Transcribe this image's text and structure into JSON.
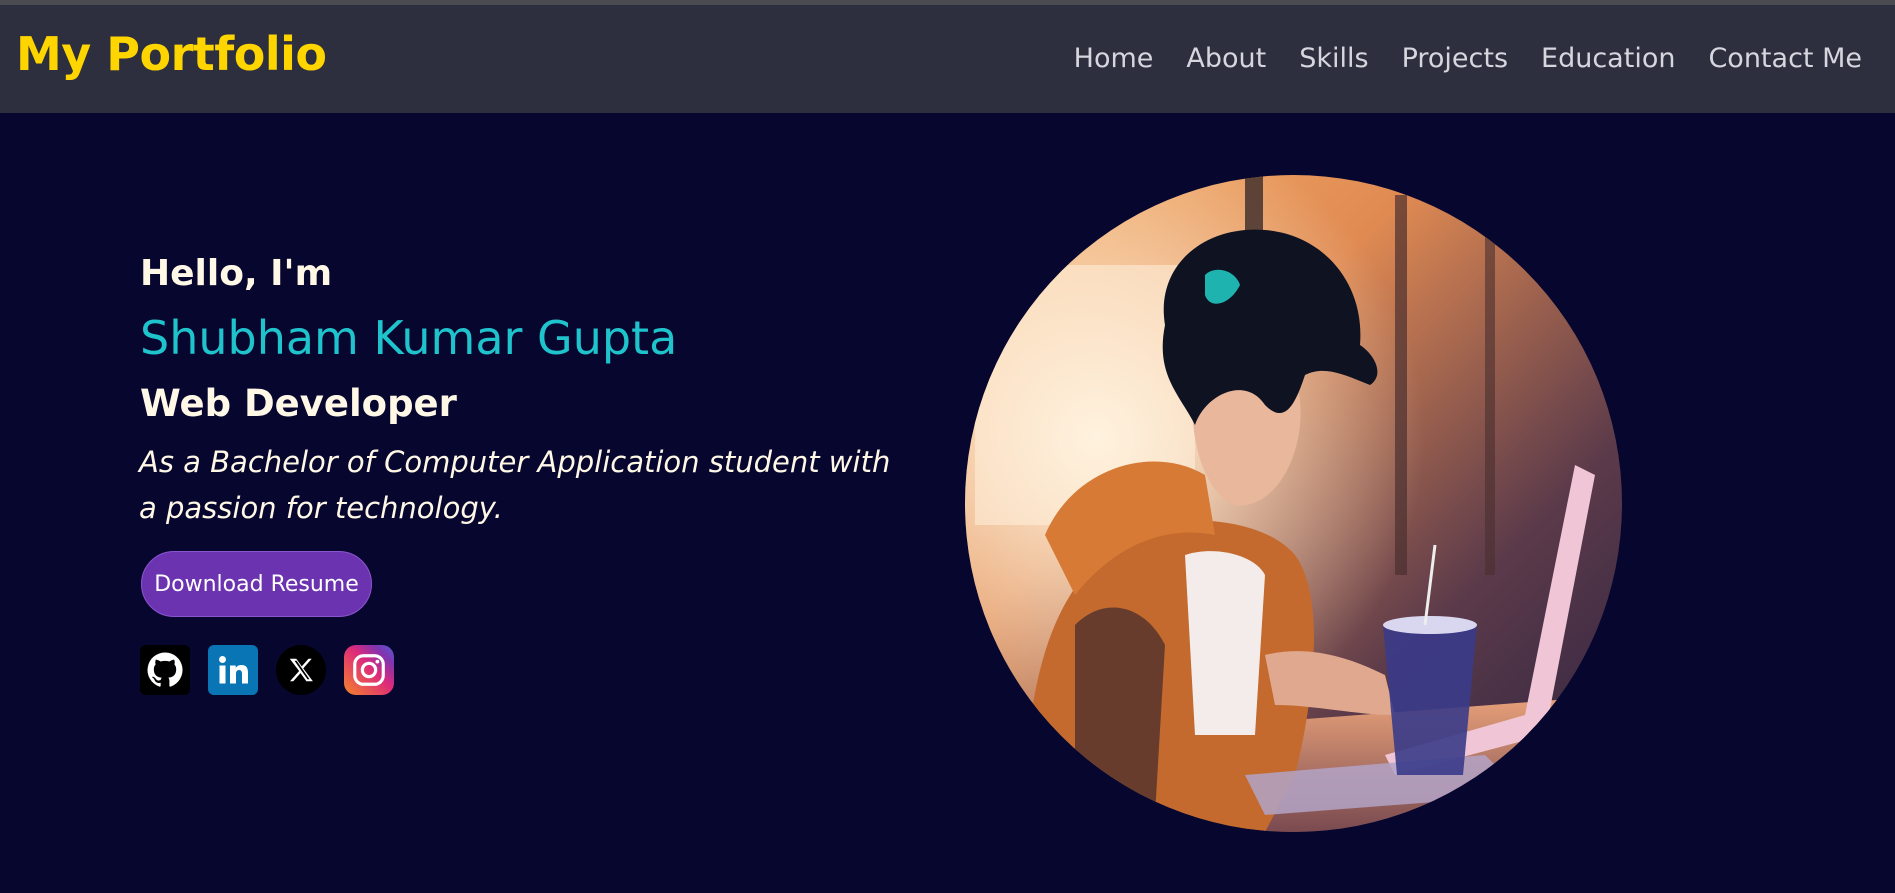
{
  "header": {
    "brand": "My Portfolio",
    "nav": [
      "Home",
      "About",
      "Skills",
      "Projects",
      "Education",
      "Contact Me"
    ]
  },
  "hero": {
    "greeting": "Hello, I'm",
    "name": "Shubham Kumar Gupta",
    "role": "Web Developer",
    "description": "As a Bachelor of Computer Application student with a passion for technology.",
    "resume_button": "Download Resume",
    "socials": [
      {
        "icon": "github-icon"
      },
      {
        "icon": "linkedin-icon"
      },
      {
        "icon": "x-icon"
      },
      {
        "icon": "instagram-icon"
      }
    ],
    "portrait": "anime-style illustration of a young person with dark spiky hair in an orange hoodie typing on a laptop in a cafe with a drink cup"
  },
  "colors": {
    "background": "#07062e",
    "navbar": "#2d2f3e",
    "brand": "#ffd500",
    "name": "#1ec3cc",
    "text": "#fff8e6",
    "button": "#6b33b0"
  }
}
